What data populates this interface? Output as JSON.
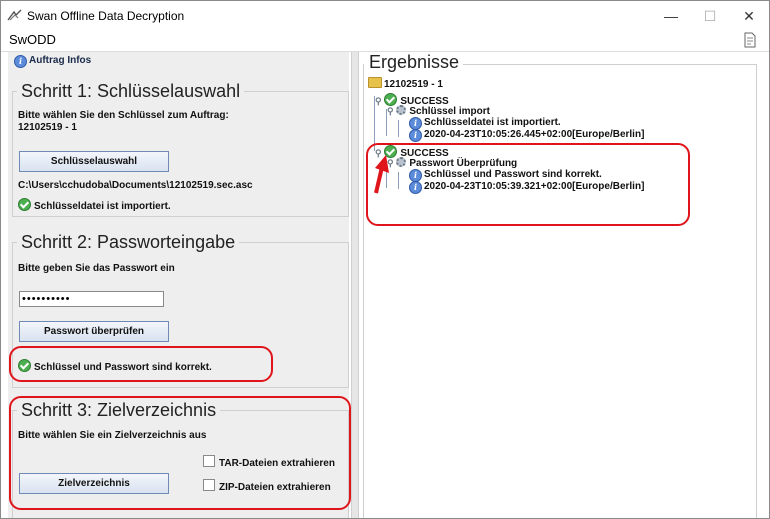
{
  "window": {
    "title": "Swan Offline Data Decryption",
    "app_name": "SwODD",
    "min_label": "—",
    "max_label": "☐",
    "close_label": "✕"
  },
  "left": {
    "info_link": "Auftrag Infos",
    "step1": {
      "legend": "Schritt 1: Schlüsselauswahl",
      "text_line1": "Bitte wählen Sie den Schlüssel zum Auftrag:",
      "text_line2": "12102519 - 1",
      "button": "Schlüsselauswahl",
      "path": "C:\\Users\\cchudoba\\Documents\\12102519.sec.asc",
      "status": "Schlüsseldatei ist importiert."
    },
    "step2": {
      "legend": "Schritt 2: Passworteingabe",
      "text": "Bitte geben Sie das Passwort ein",
      "password_value": "••••••••••",
      "button": "Passwort überprüfen",
      "status": "Schlüssel und Passwort sind korrekt."
    },
    "step3": {
      "legend": "Schritt 3: Zielverzeichnis",
      "text": "Bitte wählen Sie ein Zielverzeichnis aus",
      "checkbox_tar": "TAR-Dateien extrahieren",
      "checkbox_zip": "ZIP-Dateien extrahieren",
      "button": "Zielverzeichnis"
    }
  },
  "results": {
    "title": "Ergebnisse",
    "root": "12102519 - 1",
    "groups": [
      {
        "status": "SUCCESS",
        "task": "Schlüssel import",
        "details": [
          "Schlüsseldatei ist importiert.",
          "2020-04-23T10:05:26.445+02:00[Europe/Berlin]"
        ]
      },
      {
        "status": "SUCCESS",
        "task": "Passwort Überprüfung",
        "details": [
          "Schlüssel und Passwort sind korrekt.",
          "2020-04-23T10:05:39.321+02:00[Europe/Berlin]"
        ]
      }
    ]
  },
  "colors": {
    "annotation_red": "#e0151c",
    "success_green": "#4caf50",
    "button_border": "#6f8bb5"
  },
  "icons": [
    "app-icon",
    "document-icon",
    "info-icon",
    "check-icon",
    "folder-icon",
    "gear-icon",
    "red-arrow"
  ]
}
